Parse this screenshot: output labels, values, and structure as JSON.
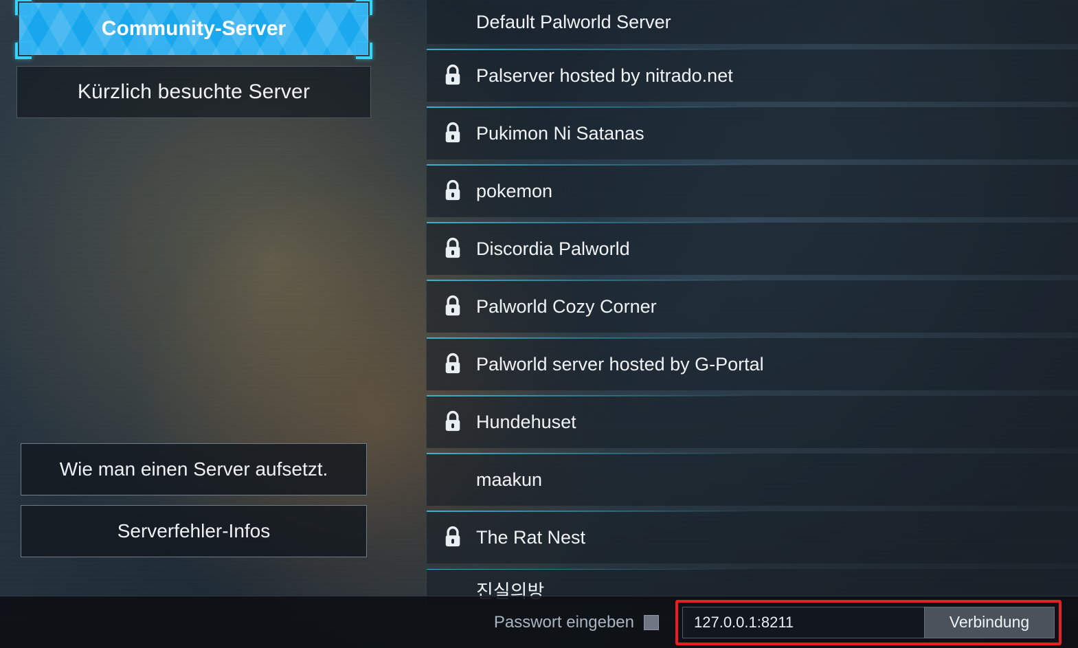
{
  "tabs": {
    "community": "Community-Server",
    "recent": "Kürzlich besuchte Server"
  },
  "help": {
    "setup": "Wie man einen Server aufsetzt.",
    "errors": "Serverfehler-Infos"
  },
  "servers": [
    {
      "name": "Default Palworld Server",
      "locked": false
    },
    {
      "name": "Palserver hosted by nitrado.net",
      "locked": true
    },
    {
      "name": "Pukimon Ni Satanas",
      "locked": true
    },
    {
      "name": "pokemon",
      "locked": true
    },
    {
      "name": "Discordia Palworld",
      "locked": true
    },
    {
      "name": "Palworld Cozy Corner",
      "locked": true
    },
    {
      "name": "Palworld server hosted by G-Portal",
      "locked": true
    },
    {
      "name": "Hundehuset",
      "locked": true
    },
    {
      "name": "maakun",
      "locked": false
    },
    {
      "name": "The Rat Nest",
      "locked": true
    },
    {
      "name": "진실의방",
      "locked": false
    }
  ],
  "bottom": {
    "password_label": "Passwort eingeben",
    "ip_value": "127.0.0.1:8211",
    "connect_label": "Verbindung"
  },
  "colors": {
    "accent_cyan": "#35d4ff",
    "tab_blue": "#18a7ee",
    "highlight_red": "#ec1c24"
  }
}
